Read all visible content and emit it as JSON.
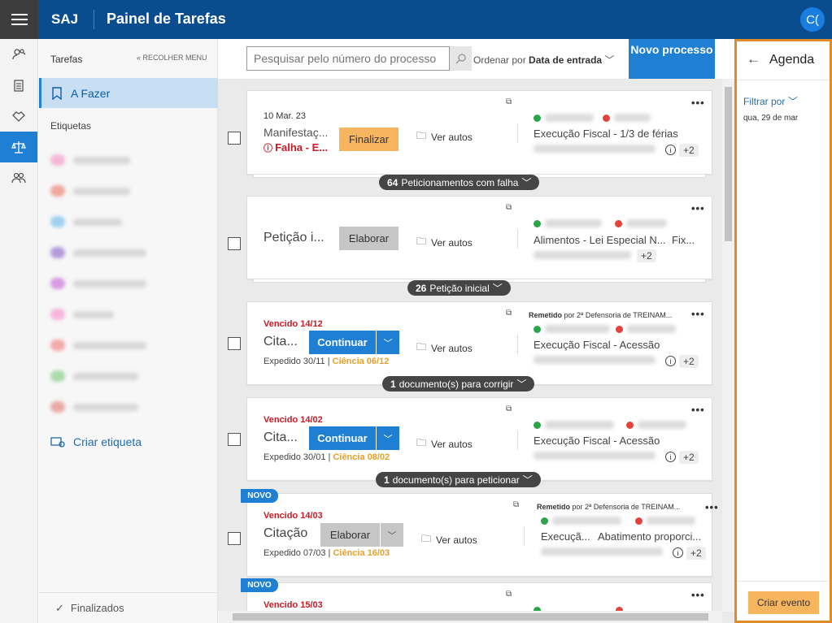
{
  "app": {
    "brand": "SAJ",
    "title": "Painel de Tarefas",
    "user_initials": "C("
  },
  "sidebar": {
    "header": "Tarefas",
    "collapse": "« RECOLHER MENU",
    "active_item": "A Fazer",
    "labels_header": "Etiquetas",
    "create_label": "Criar etiqueta",
    "finished": "Finalizados"
  },
  "toolbar": {
    "search_placeholder": "Pesquisar pelo número do processo",
    "order_prefix": "Ordenar por",
    "order_value": "Data de entrada",
    "new_process": "Novo processo"
  },
  "cards": [
    {
      "date": "10 Mar. 23",
      "title": "Manifestaç...",
      "status": "Falha - E...",
      "action": "Finalizar",
      "view": "Ver autos",
      "class": "Execução Fiscal - 1/3 de férias",
      "more": "+2"
    },
    {
      "title": "Petição i...",
      "action": "Elaborar",
      "view": "Ver autos",
      "class": "Alimentos - Lei Especial N...",
      "class2": "Fix...",
      "more": "+2"
    },
    {
      "due": "Vencido 14/12",
      "title": "Cita...",
      "action": "Continuar",
      "view": "Ver autos",
      "expedido": "Expedido 30/11",
      "ciencia": "Ciência 06/12",
      "remetido": "Remetido",
      "remetido_by": "por 2ª Defensoria de TREINAM...",
      "class": "Execução Fiscal - Acessão",
      "more": "+2"
    },
    {
      "due": "Vencido 14/02",
      "title": "Cita...",
      "action": "Continuar",
      "view": "Ver autos",
      "expedido": "Expedido 30/01",
      "ciencia": "Ciência 08/02",
      "class": "Execução Fiscal - Acessão",
      "more": "+2"
    },
    {
      "badge": "NOVO",
      "due": "Vencido 14/03",
      "title": "Citação",
      "action": "Elaborar",
      "view": "Ver autos",
      "expedido": "Expedido 07/03",
      "ciencia": "Ciência 16/03",
      "remetido": "Remetido",
      "remetido_by": "por 2ª Defensoria de TREINAM...",
      "class": "Execuçã...",
      "class2": "Abatimento proporci...",
      "more": "+2"
    },
    {
      "badge": "NOVO",
      "due": "Vencido 15/03"
    }
  ],
  "groups": [
    {
      "count": "64",
      "label": "Peticionamentos com falha"
    },
    {
      "count": "26",
      "label": "Petição inicial"
    },
    {
      "count": "1",
      "label": "documento(s) para corrigir"
    },
    {
      "count": "1",
      "label": "documento(s) para peticionar"
    }
  ],
  "agenda": {
    "title": "Agenda",
    "filter": "Filtrar por",
    "date": "qua, 29 de mar",
    "create": "Criar evento"
  },
  "colors": {
    "primary": "#0a4d8f",
    "accent": "#1f7fd3",
    "orange": "#f8b560",
    "danger": "#c81b25",
    "warn": "#e6a12a"
  }
}
